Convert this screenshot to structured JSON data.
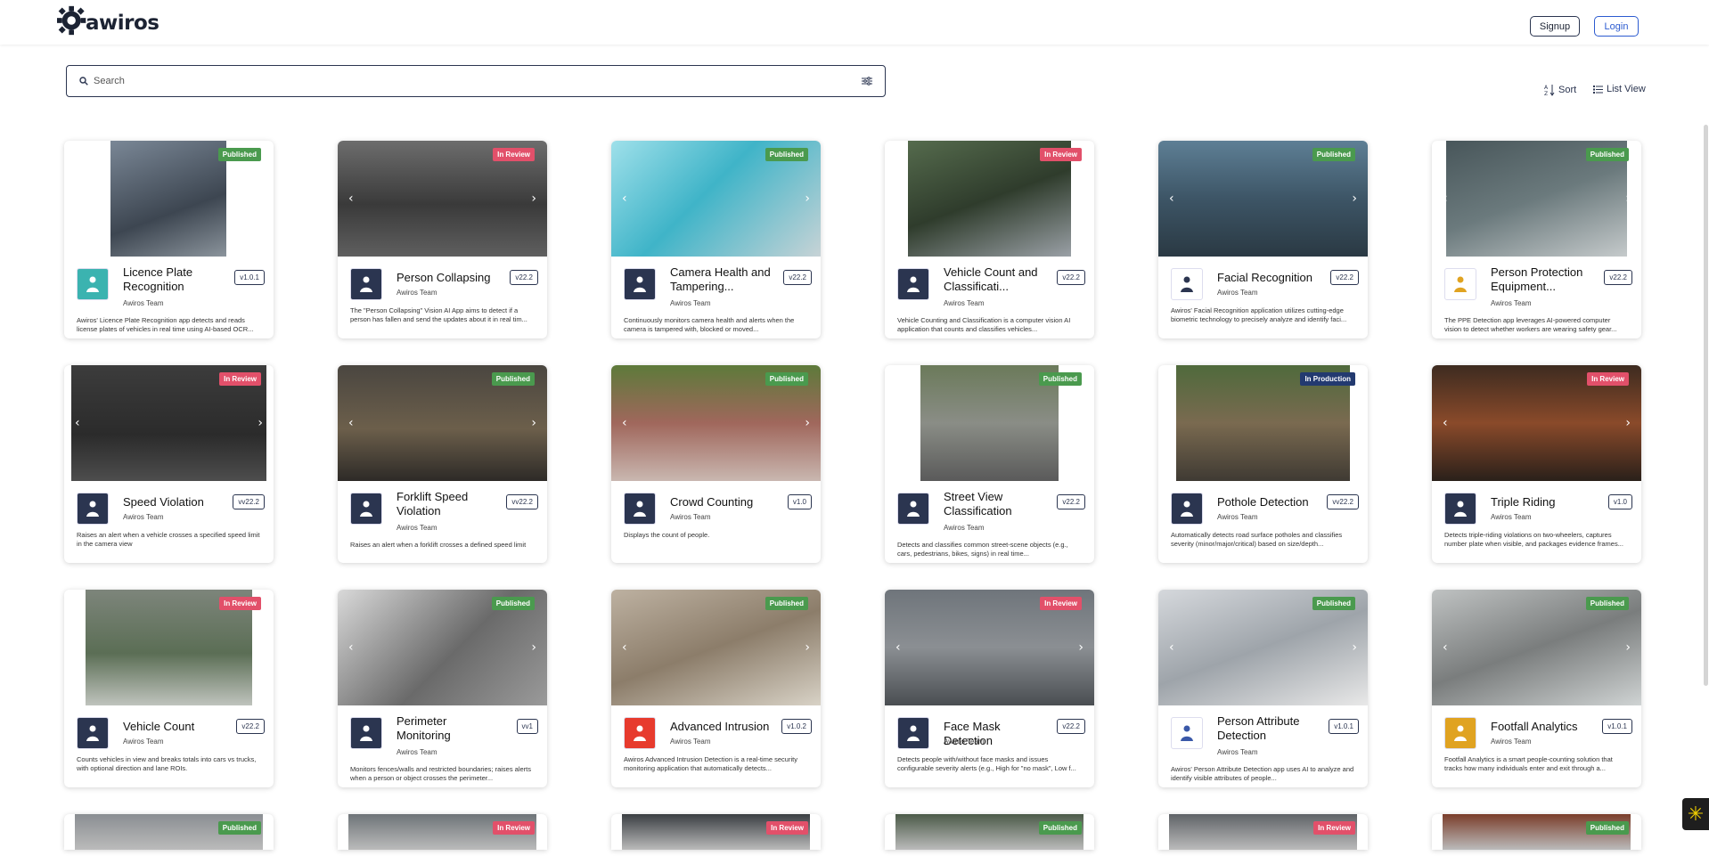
{
  "header": {
    "logo_text": "awiros",
    "signup_label": "Signup",
    "login_label": "Login"
  },
  "search": {
    "placeholder": "Search"
  },
  "toolbar": {
    "sort_label": "Sort",
    "list_view_label": "List View"
  },
  "colors": {
    "published": "#4a9a4e",
    "in_review": "#e2506a",
    "in_production": "#233a70",
    "accent": "#2c5bd0"
  },
  "apps": [
    {
      "name": "Licence Plate Recognition",
      "team": "Awiros Team",
      "version": "v1.0.1",
      "status": "Published",
      "icon": "license-plate-icon",
      "desc": "Awiros' Licence Plate Recognition app detects and reads license plates of vehicles in real time using AI-based OCR..."
    },
    {
      "name": "Person Collapsing",
      "team": "Awiros Team",
      "version": "v22.2",
      "status": "In Review",
      "icon": "person-falling-icon",
      "desc": "The \"Person Collapsing\" Vision AI App aims to detect if a person has fallen and send the updates about it in real tim..."
    },
    {
      "name": "Camera Health and Tampering...",
      "team": "Awiros Team",
      "version": "v22.2",
      "status": "Published",
      "icon": "hand-tap-icon",
      "desc": "Continuously monitors camera health and alerts when the camera is tampered with, blocked or moved..."
    },
    {
      "name": "Vehicle Count and Classificati...",
      "team": "Awiros Team",
      "version": "v22.2",
      "status": "In Review",
      "icon": "vehicle-count-icon",
      "desc": "Vehicle Counting and Classification is a computer vision AI application that counts and classifies vehicles..."
    },
    {
      "name": "Facial Recognition",
      "team": "Awiros Team",
      "version": "v22.2",
      "status": "Published",
      "icon": "face-scan-icon",
      "desc": "Awiros' Facial Recognition application utilizes cutting-edge biometric technology to precisely analyze and identify faci..."
    },
    {
      "name": "Person Protection Equipment...",
      "team": "Awiros Team",
      "version": "v22.2",
      "status": "Published",
      "icon": "hard-hat-icon",
      "desc": "The PPE Detection app leverages AI-powered computer vision to detect whether workers are wearing safety gear..."
    },
    {
      "name": "Speed Violation",
      "team": "Awiros Team",
      "version": "vv22.2",
      "status": "In Review",
      "icon": "speeding-car-icon",
      "desc": "Raises an alert when a vehicle crosses a specified speed limit in the camera view"
    },
    {
      "name": "Forklift Speed Violation",
      "team": "Awiros Team",
      "version": "vv22.2",
      "status": "Published",
      "icon": "speeding-car-icon",
      "desc": "Raises an alert when a forklift crosses a defined speed limit"
    },
    {
      "name": "Crowd Counting",
      "team": "Awiros Team",
      "version": "v1.0",
      "status": "Published",
      "icon": "crowd-icon",
      "desc": "Displays the count of people."
    },
    {
      "name": "Street View Classification",
      "team": "Awiros Team",
      "version": "v22.2",
      "status": "Published",
      "icon": "road-icon",
      "desc": "Detects and classifies common street-scene objects (e.g., cars, pedestrians, bikes, signs) in real time..."
    },
    {
      "name": "Pothole Detection",
      "team": "Awiros Team",
      "version": "vv22.2",
      "status": "In Production",
      "icon": "pothole-icon",
      "desc": "Automatically detects road surface potholes and classifies severity (minor/major/critical) based on size/depth..."
    },
    {
      "name": "Triple Riding",
      "team": "Awiros Team",
      "version": "v1.0",
      "status": "In Review",
      "icon": "bike-riders-icon",
      "desc": "Detects triple-riding violations on two-wheelers, captures number plate when visible, and packages evidence frames..."
    },
    {
      "name": "Vehicle Count",
      "team": "Awiros Team",
      "version": "v22.2",
      "status": "In Review",
      "icon": "car-front-icon",
      "desc": "Counts vehicles in view and breaks totals into cars vs trucks, with optional direction and lane ROIs."
    },
    {
      "name": "Perimeter Monitoring",
      "team": "Awiros Team",
      "version": "vv1",
      "status": "Published",
      "icon": "perimeter-walk-icon",
      "desc": "Monitors fences/walls and restricted boundaries; raises alerts when a person or object crosses the perimeter..."
    },
    {
      "name": "Advanced Intrusion",
      "team": "Awiros Team",
      "version": "v1.0.2",
      "status": "Published",
      "icon": "running-person-icon",
      "desc": "Awiros Advanced Intrusion Detection is a real-time security monitoring application that automatically detects..."
    },
    {
      "name": "Face Mask Detection",
      "team": "Awiros Team",
      "version": "v22.2",
      "status": "In Review",
      "icon": "face-mask-icon",
      "desc": "Detects people with/without face masks and issues configurable severity alerts (e.g., High for \"no mask\", Low f..."
    },
    {
      "name": "Person Attribute Detection",
      "team": "Awiros Team",
      "version": "v1.0.1",
      "status": "Published",
      "icon": "person-attribute-icon",
      "desc": "Awiros' Person Attribute Detection app uses AI to analyze and identify visible attributes of people..."
    },
    {
      "name": "Footfall Analytics",
      "team": "Awiros Team",
      "version": "v1.0.1",
      "status": "Published",
      "icon": "footfall-icon",
      "desc": "Footfall Analytics is a smart people-counting solution that tracks how many individuals enter and exit through a..."
    }
  ],
  "partial_row_statuses": [
    "Published",
    "In Review",
    "In Review",
    "Published",
    "In Review",
    "Published"
  ]
}
